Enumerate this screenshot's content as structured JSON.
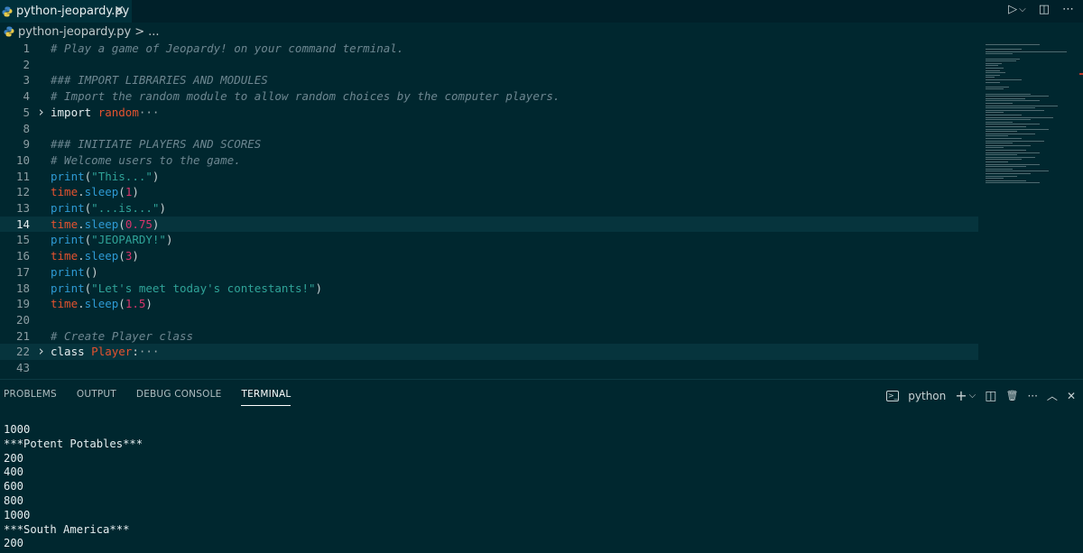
{
  "tab": {
    "filename": "python-jeopardy.py",
    "close_glyph": "✕"
  },
  "tab_actions": {
    "run": "▷",
    "run_menu": "⌵",
    "split": "◫",
    "more": "⋯"
  },
  "breadcrumb": {
    "file": "python-jeopardy.py",
    "separator": ">",
    "ellipsis": "..."
  },
  "editor": {
    "lines": [
      {
        "num": "1",
        "tokens": [
          [
            "cm",
            "# Play a game of Jeopardy! on your command terminal."
          ]
        ]
      },
      {
        "num": "2",
        "tokens": []
      },
      {
        "num": "3",
        "tokens": [
          [
            "cm",
            "### IMPORT LIBRARIES AND MODULES"
          ]
        ]
      },
      {
        "num": "4",
        "tokens": [
          [
            "cm",
            "# Import the random module to allow random choices by the computer players."
          ]
        ]
      },
      {
        "num": "5",
        "fold": true,
        "tokens": [
          [
            "kw",
            "import "
          ],
          [
            "mod",
            "random"
          ],
          [
            "dots",
            "···"
          ]
        ]
      },
      {
        "num": "8",
        "tokens": []
      },
      {
        "num": "9",
        "tokens": [
          [
            "cm",
            "### INITIATE PLAYERS AND SCORES"
          ]
        ]
      },
      {
        "num": "10",
        "tokens": [
          [
            "cm",
            "# Welcome users to the game."
          ]
        ]
      },
      {
        "num": "11",
        "tokens": [
          [
            "fn",
            "print"
          ],
          [
            "punc",
            "("
          ],
          [
            "str",
            "\"This...\""
          ],
          [
            "punc",
            ")"
          ]
        ]
      },
      {
        "num": "12",
        "tokens": [
          [
            "mod",
            "time"
          ],
          [
            "punc",
            "."
          ],
          [
            "fn",
            "sleep"
          ],
          [
            "punc",
            "("
          ],
          [
            "num",
            "1"
          ],
          [
            "punc",
            ")"
          ]
        ]
      },
      {
        "num": "13",
        "tokens": [
          [
            "fn",
            "print"
          ],
          [
            "punc",
            "("
          ],
          [
            "str",
            "\"...is...\""
          ],
          [
            "punc",
            ")"
          ]
        ]
      },
      {
        "num": "14",
        "active": true,
        "tokens": [
          [
            "mod",
            "time"
          ],
          [
            "punc",
            "."
          ],
          [
            "fn",
            "sleep"
          ],
          [
            "punc",
            "("
          ],
          [
            "num",
            "0.75"
          ],
          [
            "punc",
            ")"
          ]
        ]
      },
      {
        "num": "15",
        "tokens": [
          [
            "fn",
            "print"
          ],
          [
            "punc",
            "("
          ],
          [
            "str",
            "\"JEOPARDY!\""
          ],
          [
            "punc",
            ")"
          ]
        ]
      },
      {
        "num": "16",
        "tokens": [
          [
            "mod",
            "time"
          ],
          [
            "punc",
            "."
          ],
          [
            "fn",
            "sleep"
          ],
          [
            "punc",
            "("
          ],
          [
            "num",
            "3"
          ],
          [
            "punc",
            ")"
          ]
        ]
      },
      {
        "num": "17",
        "tokens": [
          [
            "fn",
            "print"
          ],
          [
            "punc",
            "()"
          ]
        ]
      },
      {
        "num": "18",
        "tokens": [
          [
            "fn",
            "print"
          ],
          [
            "punc",
            "("
          ],
          [
            "str",
            "\"Let's meet today's contestants!\""
          ],
          [
            "punc",
            ")"
          ]
        ]
      },
      {
        "num": "19",
        "tokens": [
          [
            "mod",
            "time"
          ],
          [
            "punc",
            "."
          ],
          [
            "fn",
            "sleep"
          ],
          [
            "punc",
            "("
          ],
          [
            "num",
            "1.5"
          ],
          [
            "punc",
            ")"
          ]
        ]
      },
      {
        "num": "20",
        "tokens": []
      },
      {
        "num": "21",
        "tokens": [
          [
            "cm",
            "# Create Player class"
          ]
        ]
      },
      {
        "num": "22",
        "fold": true,
        "hl": true,
        "tokens": [
          [
            "kw",
            "class "
          ],
          [
            "mod",
            "Player"
          ],
          [
            "punc",
            ":"
          ],
          [
            "dots",
            "···"
          ]
        ]
      },
      {
        "num": "43",
        "tokens": []
      }
    ]
  },
  "panel": {
    "tabs": [
      "PROBLEMS",
      "OUTPUT",
      "DEBUG CONSOLE",
      "TERMINAL"
    ],
    "active_tab": "TERMINAL",
    "shell_label": "python",
    "actions": {
      "add": "+",
      "add_menu": "⌵",
      "split": "◫",
      "trash": "🗑",
      "more": "···",
      "maximize": "︿",
      "close": "✕"
    }
  },
  "terminal": {
    "lines": [
      "1000",
      "***Potent Potables***",
      "200",
      "400",
      "600",
      "800",
      "1000",
      "***South America***",
      "200"
    ]
  }
}
